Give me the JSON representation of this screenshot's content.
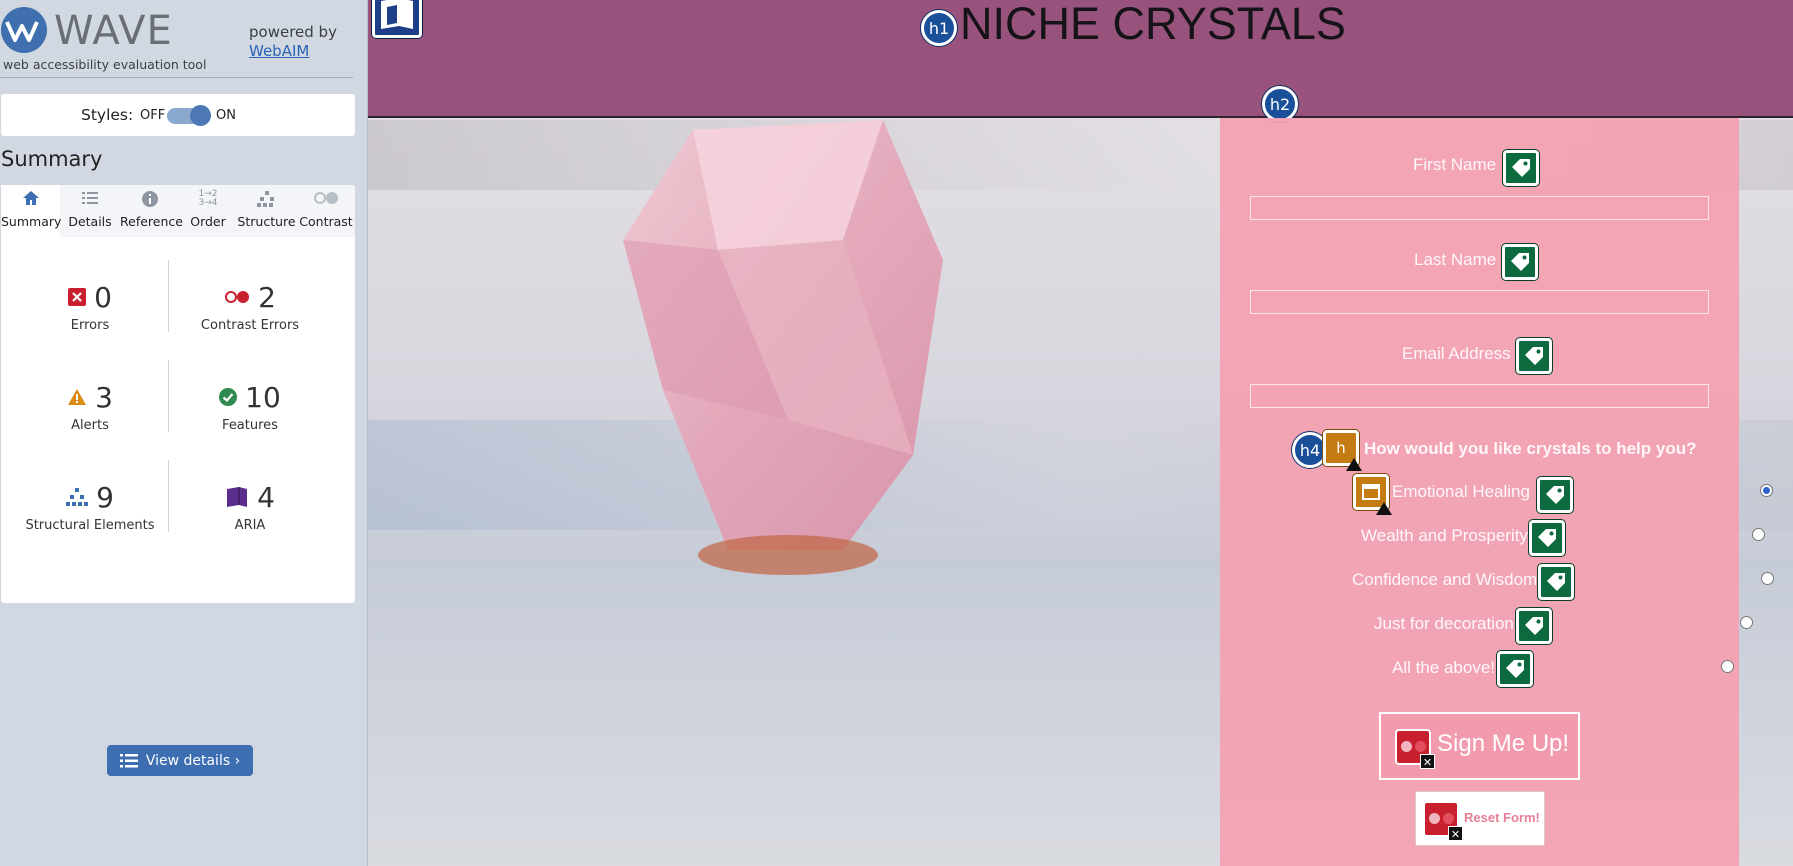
{
  "wave": {
    "logo_text": "WAVE",
    "tagline": "web accessibility evaluation tool",
    "powered_by": "powered by",
    "webaim_link": "WebAIM",
    "styles_label": "Styles:",
    "styles_off": "OFF",
    "styles_on": "ON",
    "styles_state": "on",
    "summary_heading": "Summary",
    "tabs": [
      {
        "label": "Summary",
        "icon": "home-icon",
        "active": true
      },
      {
        "label": "Details",
        "icon": "list-icon",
        "active": false
      },
      {
        "label": "Reference",
        "icon": "info-icon",
        "active": false
      },
      {
        "label": "Order",
        "icon": "order-icon",
        "active": false
      },
      {
        "label": "Structure",
        "icon": "structure-icon",
        "active": false
      },
      {
        "label": "Contrast",
        "icon": "contrast-icon",
        "active": false
      }
    ],
    "stats": {
      "errors": {
        "count": "0",
        "label": "Errors",
        "color": "#c8202f"
      },
      "contrast_errors": {
        "count": "2",
        "label": "Contrast Errors",
        "color": "#c8202f"
      },
      "alerts": {
        "count": "3",
        "label": "Alerts",
        "color": "#d98b14"
      },
      "features": {
        "count": "10",
        "label": "Features",
        "color": "#2f8a4f"
      },
      "structural": {
        "count": "9",
        "label": "Structural Elements",
        "color": "#3d6eb1"
      },
      "aria": {
        "count": "4",
        "label": "ARIA",
        "color": "#5b2d8c"
      }
    },
    "view_details": "View details ›"
  },
  "page": {
    "title": "NICHE CRYSTALS",
    "banner_color": "#98537d",
    "form_color": "#f4a0b2",
    "form": {
      "fields": [
        {
          "label": "First Name",
          "value": ""
        },
        {
          "label": "Last Name",
          "value": ""
        },
        {
          "label": "Email Address",
          "value": ""
        }
      ],
      "question": "How would you like crystals to help you?",
      "options": [
        {
          "label": "Emotional Healing",
          "checked": true
        },
        {
          "label": "Wealth and Prosperity",
          "checked": false
        },
        {
          "label": "Confidence and Wisdom",
          "checked": false
        },
        {
          "label": "Just for decoration",
          "checked": false
        },
        {
          "label": "All the above!",
          "checked": false
        }
      ],
      "submit_label": "Sign Me Up!",
      "reset_label": "Reset Form!"
    },
    "wave_icons": {
      "h1": "h1",
      "h2": "h2",
      "h4": "h4",
      "alert_heading_glyph": "h"
    }
  }
}
